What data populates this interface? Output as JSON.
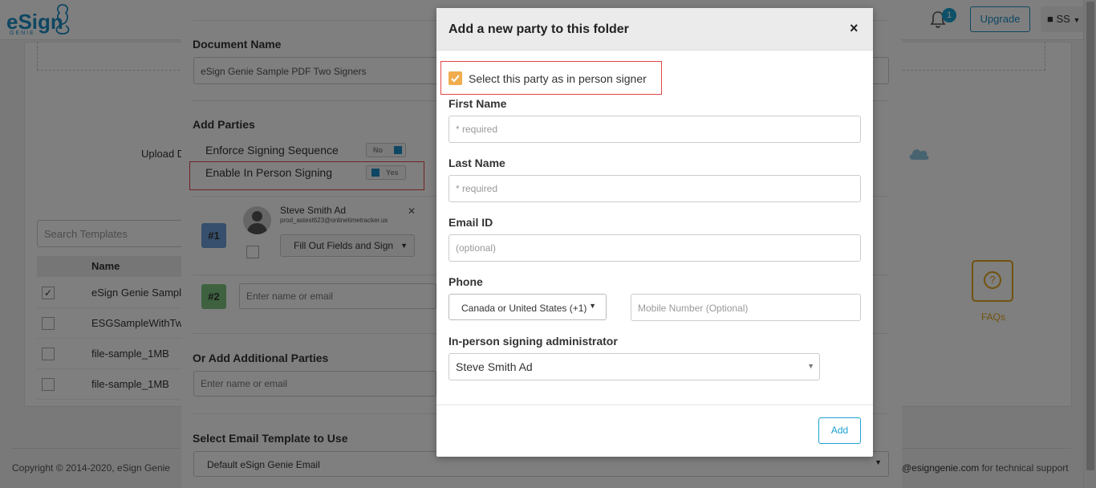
{
  "app": {
    "logo_text": "eSign",
    "logo_sub": "GENIE",
    "notification_count": "1",
    "upgrade_label": "Upgrade",
    "user_initials": "SS",
    "upload_label": "Upload D",
    "search_templates_placeholder": "Search Templates",
    "table_header_name": "Name",
    "rows": [
      {
        "name": "eSign Genie Sample",
        "checked": true
      },
      {
        "name": "ESGSampleWithTwoS",
        "checked": false
      },
      {
        "name": "file-sample_1MB",
        "checked": false
      },
      {
        "name": "file-sample_1MB",
        "checked": false
      }
    ],
    "faq_label": "FAQs",
    "footer_left": "Copyright © 2014-2020, eSign Genie",
    "footer_right_email": "@esigngenie.com",
    "footer_right_text": " for technical support"
  },
  "panel": {
    "document_name_title": "Document Name",
    "document_name_value": "eSign Genie Sample PDF Two Signers",
    "add_parties_title": "Add Parties",
    "enforce_label": "Enforce Signing Sequence",
    "enforce_value": "No",
    "in_person_label": "Enable In Person Signing",
    "in_person_value": "Yes",
    "party1_num": "#1",
    "party1_name": "Steve Smith Ad",
    "party1_email": "prod_astest623@onlinetimetracker.us",
    "party1_action": "Fill Out Fields and Sign",
    "party2_num": "#2",
    "party2_placeholder": "Enter name or email",
    "additional_title": "Or Add Additional Parties",
    "additional_placeholder": "Enter name or email",
    "email_template_title": "Select Email Template to Use",
    "email_template_value": "Default eSign Genie Email"
  },
  "modal": {
    "title": "Add a new party to this folder",
    "close_symbol": "×",
    "in_person_checkbox_label": "Select this party as in person signer",
    "first_name_label": "First Name",
    "first_name_placeholder": "* required",
    "last_name_label": "Last Name",
    "last_name_placeholder": "* required",
    "email_label": "Email ID",
    "email_placeholder": "(optional)",
    "phone_label": "Phone",
    "country_value": "Canada or United States (+1)",
    "mobile_placeholder": "Mobile Number (Optional)",
    "admin_label": "In-person signing administrator",
    "admin_value": "Steve Smith Ad",
    "add_label": "Add"
  },
  "colors": {
    "accent": "#1ba1d1",
    "brand": "#1c8fc6",
    "highlight": "#e24545",
    "checkbox": "#f0ad4e",
    "party1_badge": "#6a9fd8",
    "party2_badge": "#7cc47f"
  }
}
